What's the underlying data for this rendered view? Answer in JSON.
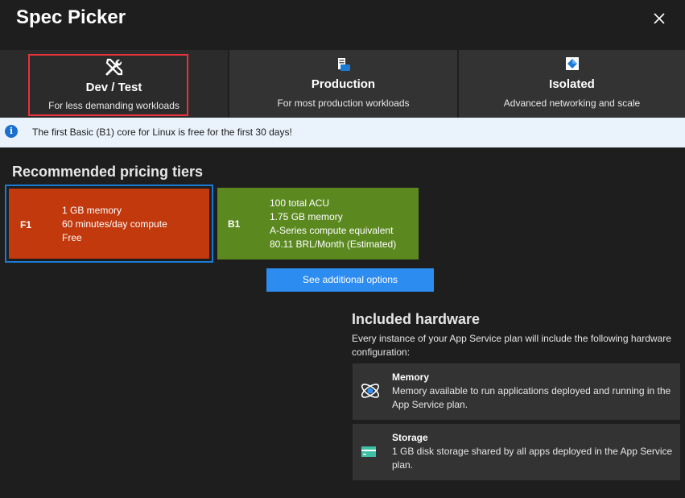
{
  "dialog": {
    "title": "Spec Picker"
  },
  "tabs": [
    {
      "name": "Dev / Test",
      "desc": "For less demanding workloads",
      "icon": "tools-icon"
    },
    {
      "name": "Production",
      "desc": "For most production workloads",
      "icon": "server-icon"
    },
    {
      "name": "Isolated",
      "desc": "Advanced networking and scale",
      "icon": "isolated-icon"
    }
  ],
  "info_banner": {
    "text": "The first Basic (B1) core for Linux is free for the first 30 days!"
  },
  "recommended": {
    "heading": "Recommended pricing tiers",
    "tiers": [
      {
        "code": "F1",
        "lines": [
          "1 GB memory",
          "60 minutes/day compute",
          "Free"
        ],
        "color": "#c1390d",
        "selected": true
      },
      {
        "code": "B1",
        "lines": [
          "100 total ACU",
          "1.75 GB memory",
          "A-Series compute equivalent",
          "80.11 BRL/Month (Estimated)"
        ],
        "color": "#5b8920",
        "selected": false
      }
    ],
    "more_button": "See additional options"
  },
  "hardware": {
    "heading": "Included hardware",
    "desc": "Every instance of your App Service plan will include the following hardware configuration:",
    "items": [
      {
        "name": "Memory",
        "text": "Memory available to run applications deployed and running in the App Service plan.",
        "icon": "memory-icon"
      },
      {
        "name": "Storage",
        "text": "1 GB disk storage shared by all apps deployed in the App Service plan.",
        "icon": "storage-icon"
      }
    ]
  },
  "colors": {
    "accent": "#2d8cf0",
    "selected_outline": "#e8323c",
    "tier_selected_border": "#1a7ad4"
  }
}
